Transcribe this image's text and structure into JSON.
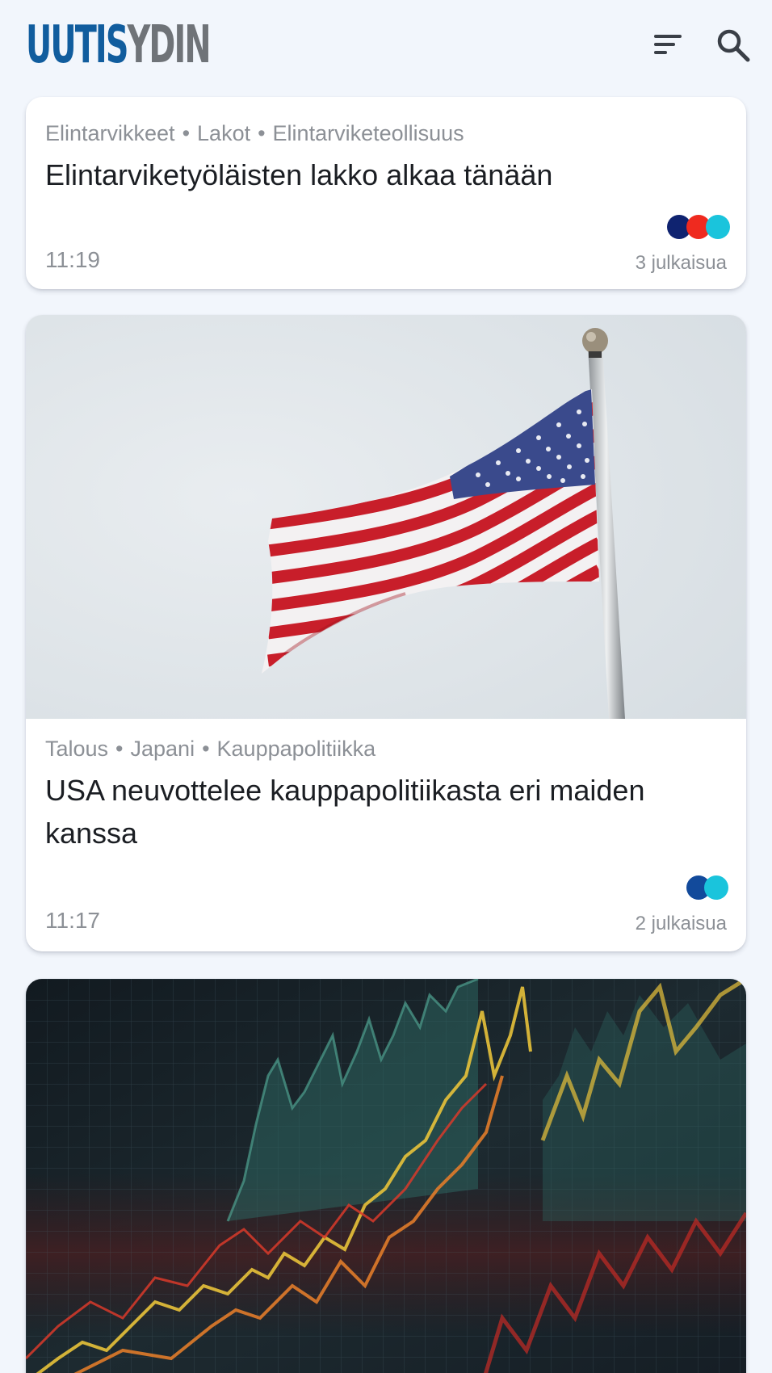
{
  "app": {
    "logo_part1": "UUTIS",
    "logo_part2": "YDIN"
  },
  "header": {
    "filter_icon": "sort-filter-icon",
    "search_icon": "search-icon"
  },
  "articles": [
    {
      "tags": [
        "Elintarvikkeet",
        "Lakot",
        "Elintarviketeollisuus"
      ],
      "separator": "•",
      "headline": "Elintarviketyöläisten lakko alkaa tänään",
      "time": "11:19",
      "count_text": "3 julkaisua",
      "source_colors": [
        "#0f2370",
        "#ef2a1f",
        "#1ac4dc"
      ]
    },
    {
      "image": "american-flag-photo",
      "tags": [
        "Talous",
        "Japani",
        "Kauppapolitiikka"
      ],
      "separator": "•",
      "headline": "USA neuvottelee kauppapolitiikasta eri maiden kanssa",
      "time": "11:17",
      "count_text": "2 julkaisua",
      "source_colors": [
        "#124a9b",
        "#1ac4dc"
      ]
    },
    {
      "image": "stock-market-chart-photo"
    }
  ],
  "colors": {
    "background": "#f2f6fc",
    "logo_blue": "#115d9e",
    "logo_grey": "#6f7378",
    "muted_text": "#8c9096",
    "headline_text": "#1b1e23"
  }
}
